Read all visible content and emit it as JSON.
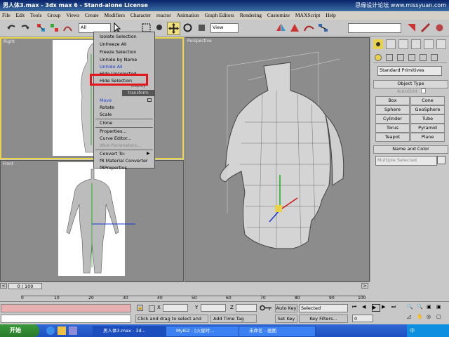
{
  "window": {
    "title": "男人体3.max - 3dx max 6 - Stand-alone License",
    "watermark": "思缘设计论坛 www.missyuan.com"
  },
  "menu": [
    "File",
    "Edit",
    "Tools",
    "Group",
    "Views",
    "Create",
    "Modifiers",
    "Character",
    "reactor",
    "Animation",
    "Graph Editors",
    "Rendering",
    "Customize",
    "MAXScript",
    "Help"
  ],
  "toolbar": {
    "selection_filter": "All",
    "ref_coord": "View"
  },
  "viewports": {
    "top_left": "Right",
    "bottom_left": "Front",
    "right": "Perspective"
  },
  "quad_menu": {
    "top_items": [
      "Isolate Selection",
      "Unfreeze All",
      "Freeze Selection",
      "Unhide by Name",
      "Unhide All",
      "Hide Unselected",
      "Hide Selection"
    ],
    "display_label": "display",
    "transform_label": "transform",
    "bottom_items": [
      "Move",
      "Rotate",
      "Scale",
      "Clone",
      "Properties...",
      "Curve Editor...",
      "Wire Parameters...",
      "Convert To:",
      "fR Material Converter",
      "fRProperties"
    ]
  },
  "command_panel": {
    "dropdown": "Standard Primitives",
    "object_type_header": "Object Type",
    "autogrid": "AutoGrid",
    "buttons": [
      "Box",
      "Cone",
      "Sphere",
      "GeoSphere",
      "Cylinder",
      "Tube",
      "Torus",
      "Pyramid",
      "Teapot",
      "Plane"
    ],
    "name_color_header": "Name and Color",
    "name_value": "Multiple Selected",
    "color_swatch": "#e8e8e8"
  },
  "timeline": {
    "frame": "0 / 100",
    "ticks": [
      "0",
      "10",
      "20",
      "30",
      "40",
      "50",
      "60",
      "70",
      "80",
      "90",
      "100"
    ]
  },
  "status": {
    "x_label": "X",
    "y_label": "Y",
    "z_label": "Z",
    "prompt": "Click and drag to select and move",
    "add_time_tag": "Add Time Tag",
    "auto_key": "Auto Key",
    "set_key": "Set Key",
    "selected": "Selected",
    "key_filters": "Key Filters...",
    "frame_value": "0"
  },
  "taskbar": {
    "start": "开始",
    "tasks": [
      "男人体3.max - 3d...",
      "MyIE2 - [火星时...",
      "未命名 - 画图"
    ],
    "tray_text": "中"
  },
  "colors": {
    "highlight": "#e4161b",
    "active_border": "#e8d24a",
    "gizmo_x": "#d01818",
    "gizmo_y": "#18b018",
    "gizmo_z": "#1838d0"
  }
}
